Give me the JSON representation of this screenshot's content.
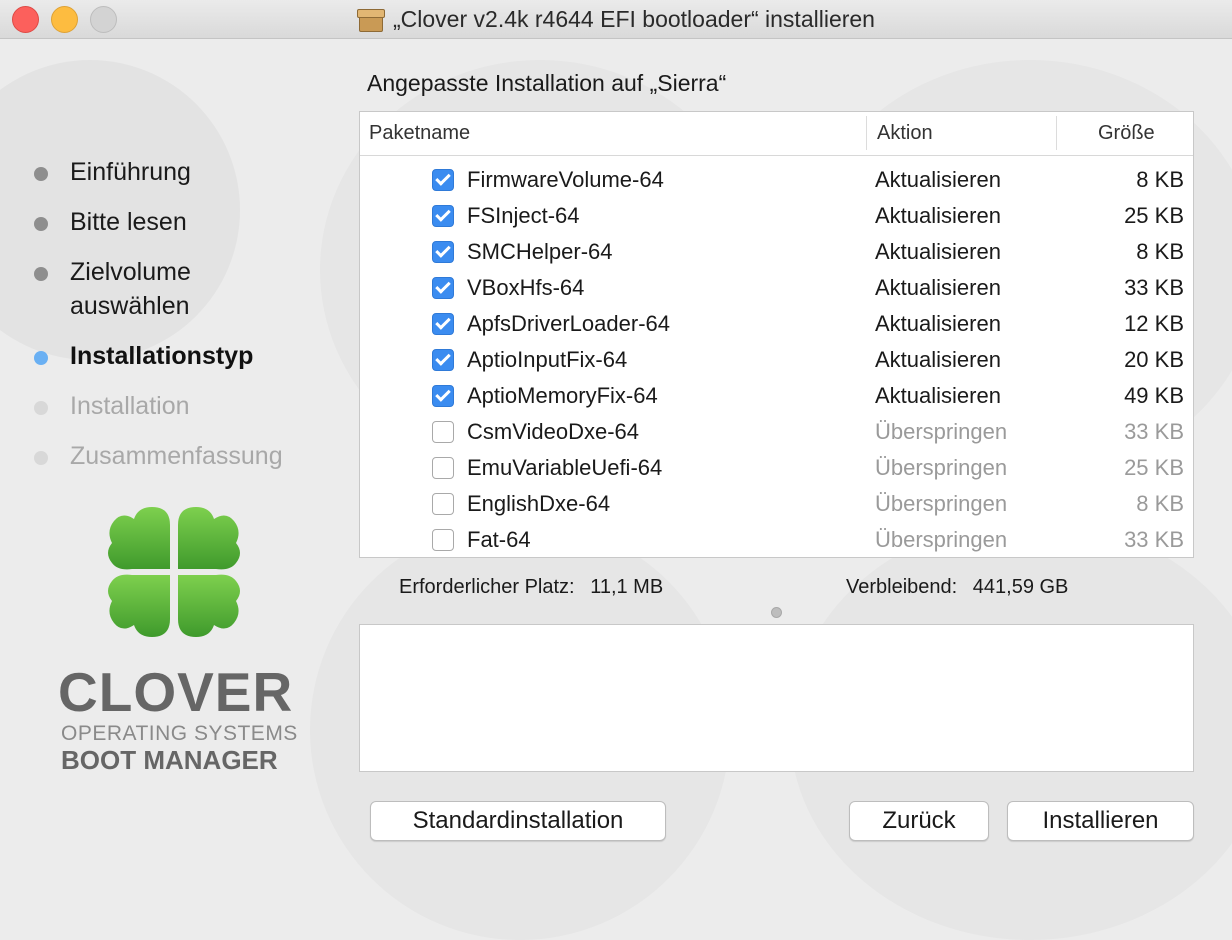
{
  "window": {
    "title": "„Clover v2.4k r4644 EFI bootloader“ installieren",
    "icon": "package-icon"
  },
  "sidebar": {
    "steps": [
      {
        "label": "Einführung",
        "state": "done"
      },
      {
        "label": "Bitte lesen",
        "state": "done"
      },
      {
        "label": "Zielvolume\nauswählen",
        "state": "done"
      },
      {
        "label": "Installationstyp",
        "state": "active"
      },
      {
        "label": "Installation",
        "state": "pending"
      },
      {
        "label": "Zusammenfassung",
        "state": "pending"
      }
    ],
    "brand": {
      "logo": "clover-leaf-logo",
      "name": "CLOVER",
      "line1": "OPERATING SYSTEMS",
      "line2": "BOOT MANAGER"
    }
  },
  "main": {
    "heading": "Angepasste Installation auf „Sierra“",
    "columns": {
      "name": "Paketname",
      "action": "Aktion",
      "size": "Größe"
    },
    "packages": [
      {
        "name": "FirmwareVolume-64",
        "checked": true,
        "action": "Aktualisieren",
        "size": "8 KB"
      },
      {
        "name": "FSInject-64",
        "checked": true,
        "action": "Aktualisieren",
        "size": "25 KB"
      },
      {
        "name": "SMCHelper-64",
        "checked": true,
        "action": "Aktualisieren",
        "size": "8 KB"
      },
      {
        "name": "VBoxHfs-64",
        "checked": true,
        "action": "Aktualisieren",
        "size": "33 KB"
      },
      {
        "name": "ApfsDriverLoader-64",
        "checked": true,
        "action": "Aktualisieren",
        "size": "12 KB"
      },
      {
        "name": "AptioInputFix-64",
        "checked": true,
        "action": "Aktualisieren",
        "size": "20 KB"
      },
      {
        "name": "AptioMemoryFix-64",
        "checked": true,
        "action": "Aktualisieren",
        "size": "49 KB"
      },
      {
        "name": "CsmVideoDxe-64",
        "checked": false,
        "action": "Überspringen",
        "size": "33 KB"
      },
      {
        "name": "EmuVariableUefi-64",
        "checked": false,
        "action": "Überspringen",
        "size": "25 KB"
      },
      {
        "name": "EnglishDxe-64",
        "checked": false,
        "action": "Überspringen",
        "size": "8 KB"
      },
      {
        "name": "Fat-64",
        "checked": false,
        "action": "Überspringen",
        "size": "33 KB"
      }
    ],
    "space": {
      "required_label": "Erforderlicher Platz:",
      "required_value": "11,1 MB",
      "remaining_label": "Verbleibend:",
      "remaining_value": "441,59 GB"
    },
    "description": ""
  },
  "buttons": {
    "standard": "Standardinstallation",
    "back": "Zurück",
    "install": "Installieren"
  },
  "colors": {
    "accent": "#3b8cf0",
    "active_step_dot": "#6ab0f3",
    "clover_green": "#5cb83a"
  }
}
